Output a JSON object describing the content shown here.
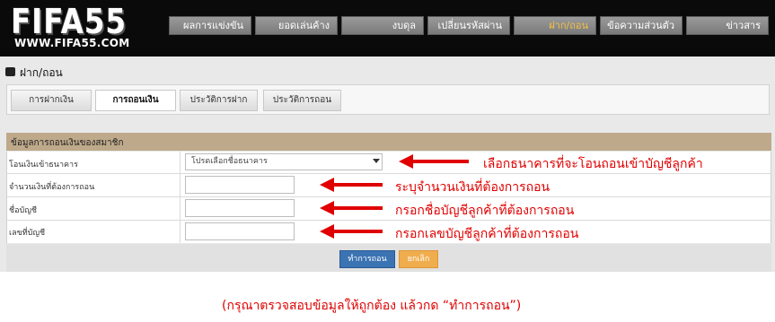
{
  "logo": {
    "text": "FIFA55",
    "url": "WWW.FIFA55.COM"
  },
  "nav": [
    {
      "label": "ผลการแข่งขัน"
    },
    {
      "label": "ยอดเล่นค้าง"
    },
    {
      "label": "งบดุล"
    },
    {
      "label": "เปลี่ยนรหัสผ่าน"
    },
    {
      "label": "ฝาก/ถอน",
      "active": true
    },
    {
      "label": "ข้อความส่วนตัว"
    },
    {
      "label": "ข่าวสาร"
    }
  ],
  "page_title": "ฝาก/ถอน",
  "tabs": [
    {
      "label": "การฝากเงิน"
    },
    {
      "label": "การถอนเงิน",
      "active": true
    },
    {
      "label": "ประวัติการฝาก"
    },
    {
      "label": "ประวัติการถอน"
    }
  ],
  "form": {
    "heading": "ข้อมูลการถอนเงินของสมาชิก",
    "bank_label": "โอนเงินเข้าธนาคาร",
    "bank_placeholder": "โปรดเลือกชื่อธนาคาร",
    "amount_label": "จำนวนเงินที่ต้องการถอน",
    "account_name_label": "ชื่อบัญชี",
    "account_number_label": "เลขที่บัญชี",
    "submit_label": "ทำการถอน",
    "cancel_label": "ยกเลิก"
  },
  "annotations": {
    "bank": "เลือกธนาคารที่จะโอนถอนเข้าบัญชีลูกค้า",
    "amount": "ระบุจำนวนเงินที่ต้องการถอน",
    "account_name": "กรอกชื่อบัญชีลูกค้าที่ต้องการถอน",
    "account_number": "กรอกเลขบัญชีลูกค้าที่ต้องการถอน",
    "note": "(กรุณาตรวจสอบข้อมูลให้ถูกต้อง แล้วกด “ทำการถอน”)",
    "color": "#e00000"
  },
  "colors": {
    "header_bg": "#0a0a0a",
    "form_heading_bg": "#bea98a",
    "submit_button": "#3b73b3",
    "cancel_button": "#f0ad4e",
    "active_nav_text": "#f5c242"
  }
}
